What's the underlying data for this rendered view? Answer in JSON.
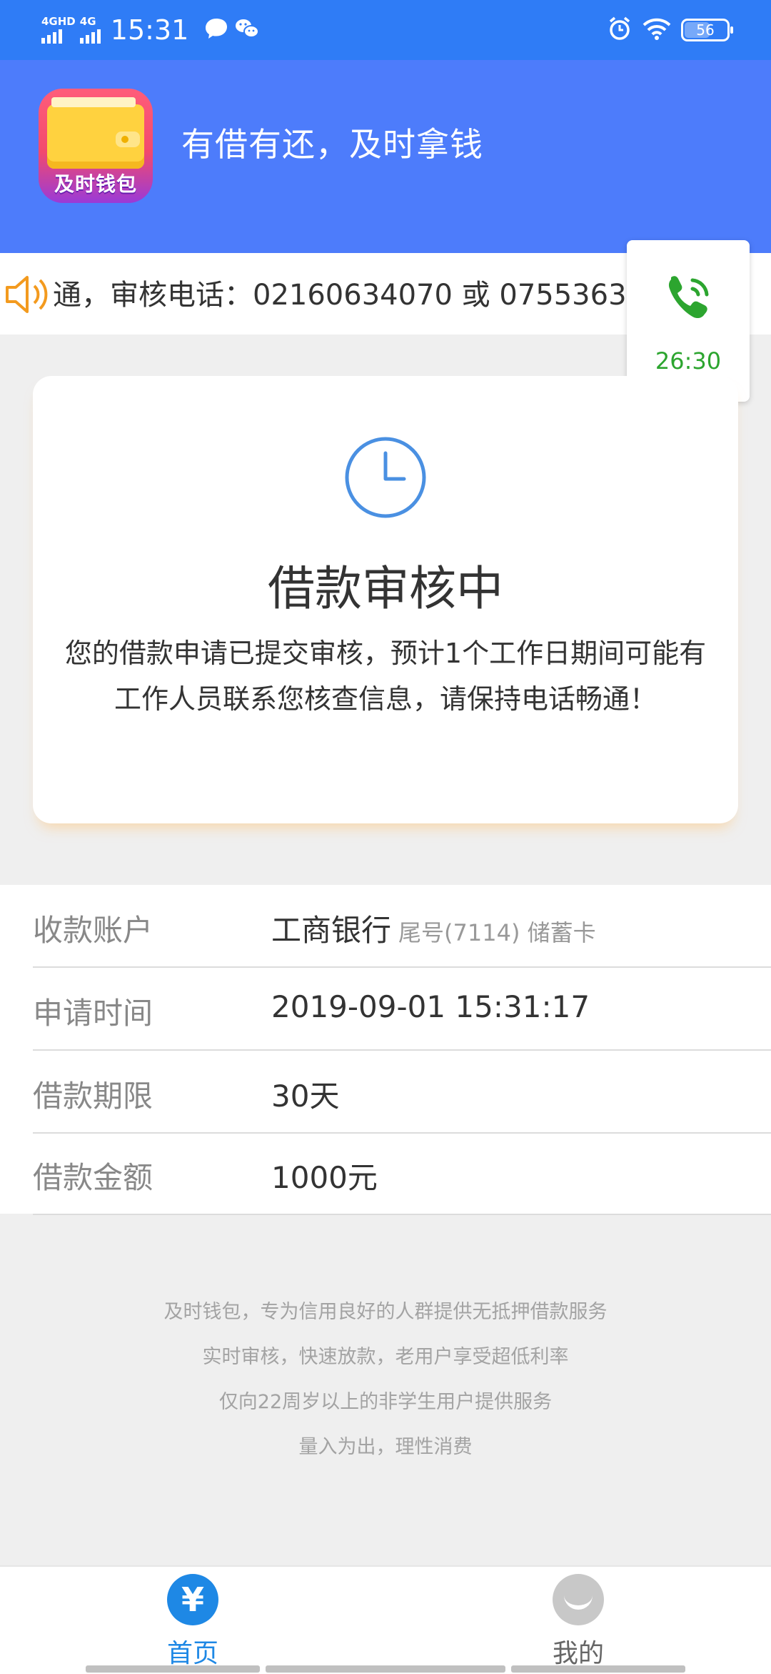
{
  "status_bar": {
    "network_1": "4GHD",
    "network_2": "4G",
    "time": "15:31",
    "battery": "56",
    "battery_level": 0.56,
    "icons": [
      "chat-bubble-icon",
      "wechat-icon",
      "alarm-icon",
      "wifi-icon",
      "battery-icon"
    ]
  },
  "header": {
    "logo_text": "及时钱包",
    "slogan": "有借有还，及时拿钱",
    "background": "#4d7cfb"
  },
  "notice": {
    "text": "通，审核电话：02160634070 或 0755363",
    "icon": "speaker-icon"
  },
  "call_button": {
    "timer": "26:30",
    "icon": "phone-icon",
    "color": "#2ca52f"
  },
  "status_card": {
    "icon": "clock-icon",
    "title": "借款审核中",
    "description": "您的借款申请已提交审核，预计1个工作日期间可能有工作人员联系您核查信息，请保持电话畅通！"
  },
  "info": {
    "account_label": "收款账户",
    "account_bank": "工商银行",
    "account_detail": "尾号(7114) 储蓄卡",
    "time_label": "申请时间",
    "time_value": "2019-09-01 15:31:17",
    "term_label": "借款期限",
    "term_value": "30天",
    "amount_label": "借款金额",
    "amount_value": "1000元"
  },
  "footer_notes": {
    "line1": "及时钱包，专为信用良好的人群提供无抵押借款服务",
    "line2": "实时审核，快速放款，老用户享受超低利率",
    "line3": "仅向22周岁以上的非学生用户提供服务",
    "line4": "量入为出，理性消费"
  },
  "tabbar": {
    "home_label": "首页",
    "home_icon_glyph": "¥",
    "mine_label": "我的",
    "active_color": "#1e88e5"
  }
}
